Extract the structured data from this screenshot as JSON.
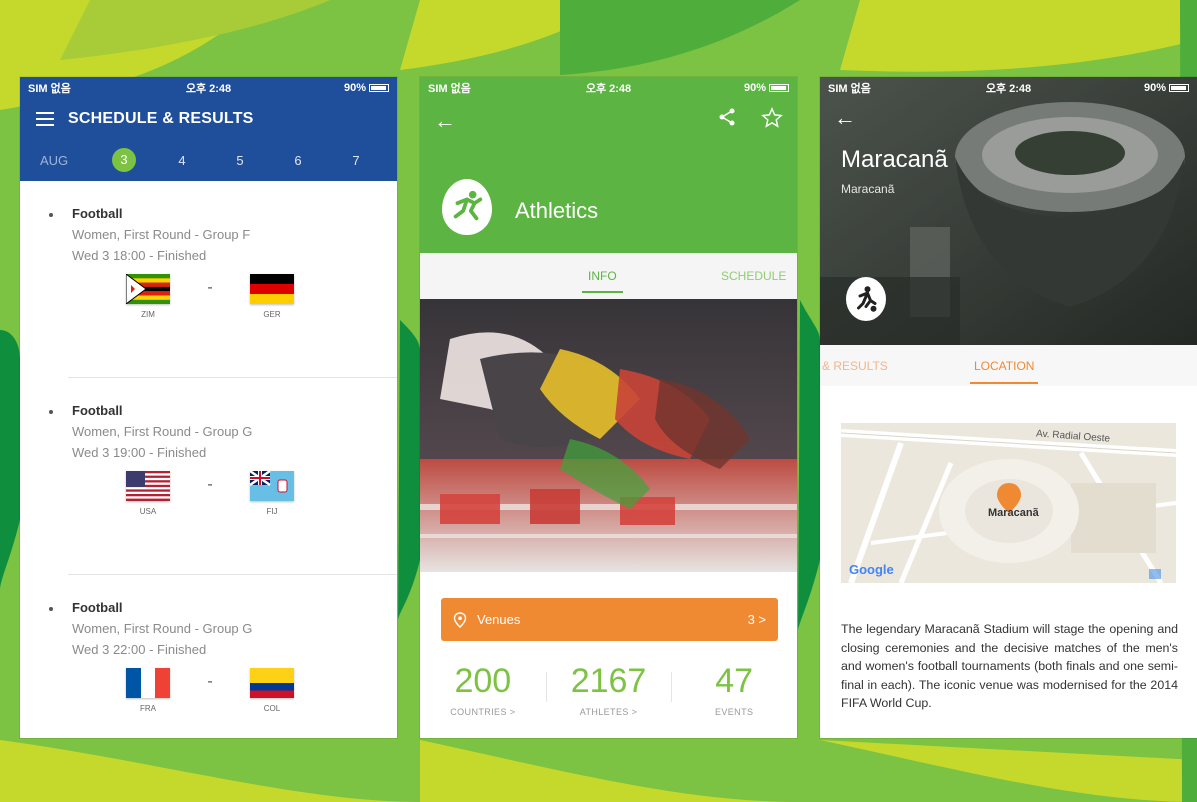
{
  "screen1": {
    "status": {
      "carrier": "SIM 없음",
      "time": "오후 2:48",
      "battery": "90%"
    },
    "title": "SCHEDULE & RESULTS",
    "month": "AUG",
    "days": [
      "3",
      "4",
      "5",
      "6",
      "7"
    ],
    "selected_day": "3",
    "matches": [
      {
        "sport": "Football",
        "round": "Women, First Round - Group F",
        "time": "Wed 3 18:00 - Finished",
        "home": "ZIM",
        "away": "GER",
        "sep": "-"
      },
      {
        "sport": "Football",
        "round": "Women, First Round - Group G",
        "time": "Wed 3 19:00 - Finished",
        "home": "USA",
        "away": "FIJ",
        "sep": "-"
      },
      {
        "sport": "Football",
        "round": "Women, First Round - Group G",
        "time": "Wed 3 22:00 - Finished",
        "home": "FRA",
        "away": "COL",
        "sep": "-"
      }
    ]
  },
  "screen2": {
    "status": {
      "carrier": "SIM 없음",
      "time": "오후 2:48",
      "battery": "90%"
    },
    "sport": "Athletics",
    "tabs": {
      "info": "INFO",
      "schedule": "SCHEDULE"
    },
    "venues": {
      "label": "Venues",
      "count": "3 >"
    },
    "stats": [
      {
        "num": "200",
        "label": "COUNTRIES >"
      },
      {
        "num": "2167",
        "label": "ATHLETES >"
      },
      {
        "num": "47",
        "label": "EVENTS"
      }
    ]
  },
  "screen3": {
    "status": {
      "carrier": "SIM 없음",
      "time": "오후 2:48",
      "battery": "90%"
    },
    "title": "Maracanã",
    "subtitle": "Maracanã",
    "tabs": {
      "results": "& RESULTS",
      "location": "LOCATION"
    },
    "map": {
      "road": "Av. Radial Oeste",
      "pin_label": "Maracanã",
      "google": "Google"
    },
    "description": "The legendary Maracanã Stadium will stage the opening and closing ceremonies and the decisive matches of the men's and women's football tournaments (both finals and one semi-final in each). The iconic venue was modernised for the 2014 FIFA World Cup."
  },
  "colors": {
    "green": "#7cc243",
    "blue": "#1f4f9a",
    "orange": "#f08a32",
    "dark_green": "#5cb442"
  }
}
